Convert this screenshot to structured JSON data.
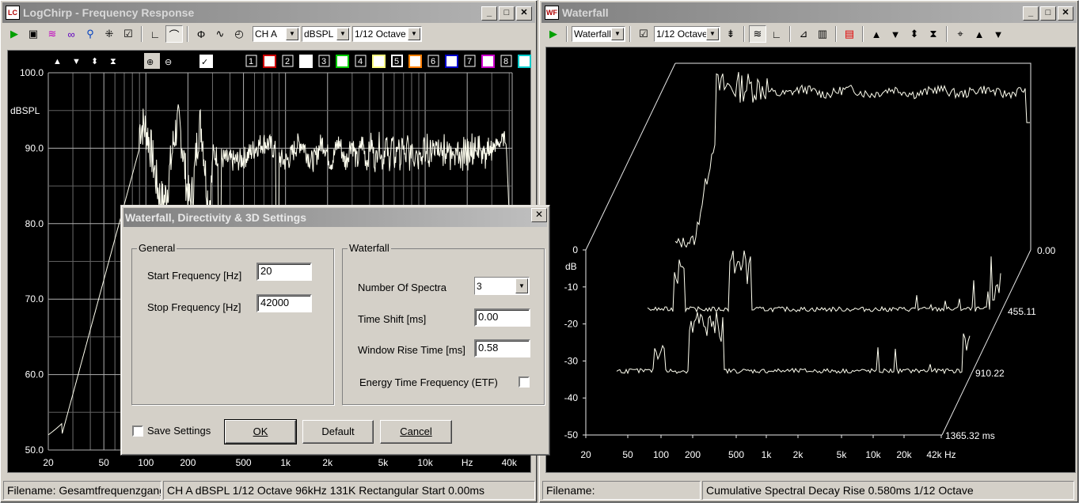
{
  "left_window": {
    "title": "LogChirp - Frequency Response",
    "channel": "CH A",
    "units": "dBSPL",
    "smoothing": "1/12 Octave",
    "trace_buttons": [
      "1",
      "2",
      "3",
      "4",
      "5",
      "6",
      "7",
      "8"
    ],
    "trace_colors": [
      "#cc0000",
      "#ffffff",
      "#00cc00",
      "#ffff80",
      "#ff8000",
      "#0000cc",
      "#cc00cc",
      "#00cccc"
    ],
    "plot": {
      "y_label": "dBSPL",
      "y_ticks": [
        "100.0",
        "90.0",
        "80.0",
        "70.0",
        "60.0",
        "50.0"
      ],
      "x_ticks": [
        "20",
        "50",
        "100",
        "200",
        "500",
        "1k",
        "2k",
        "5k",
        "10k",
        "Hz",
        "40k"
      ]
    },
    "status": {
      "filename": "Filename: Gesamtfrequenzgang MIT",
      "info": "CH A   dBSPL   1/12 Octave   96kHz   131K   Rectangular   Start 0.00ms"
    }
  },
  "right_window": {
    "title": "Waterfall",
    "mode": "Waterfall",
    "smoothing": "1/12 Octave",
    "plot": {
      "y_label": "dB",
      "y_ticks": [
        "0",
        "-10",
        "-20",
        "-30",
        "-40",
        "-50"
      ],
      "x_ticks": [
        "20",
        "50",
        "100",
        "200",
        "500",
        "1k",
        "2k",
        "5k",
        "10k",
        "20k",
        "42k Hz"
      ],
      "time_labels": [
        "0.00",
        "455.11",
        "910.22",
        "1365.32  ms"
      ]
    },
    "status": {
      "filename": "Filename:",
      "info": "Cumulative Spectral Decay   Rise 0.580ms   1/12 Octave"
    }
  },
  "dialog": {
    "title": "Waterfall, Directivity & 3D Settings",
    "general_label": "General",
    "start_freq_label": "Start Frequency [Hz]",
    "start_freq_value": "20",
    "stop_freq_label": "Stop Frequency [Hz]",
    "stop_freq_value": "42000",
    "waterfall_label": "Waterfall",
    "num_spectra_label": "Number Of Spectra",
    "num_spectra_value": "3",
    "time_shift_label": "Time Shift [ms]",
    "time_shift_value": "0.00",
    "rise_time_label": "Window Rise Time [ms]",
    "rise_time_value": "0.58",
    "etf_label": "Energy Time Frequency (ETF)",
    "save_settings_label": "Save Settings",
    "ok_label": "OK",
    "default_label": "Default",
    "cancel_label": "Cancel"
  }
}
